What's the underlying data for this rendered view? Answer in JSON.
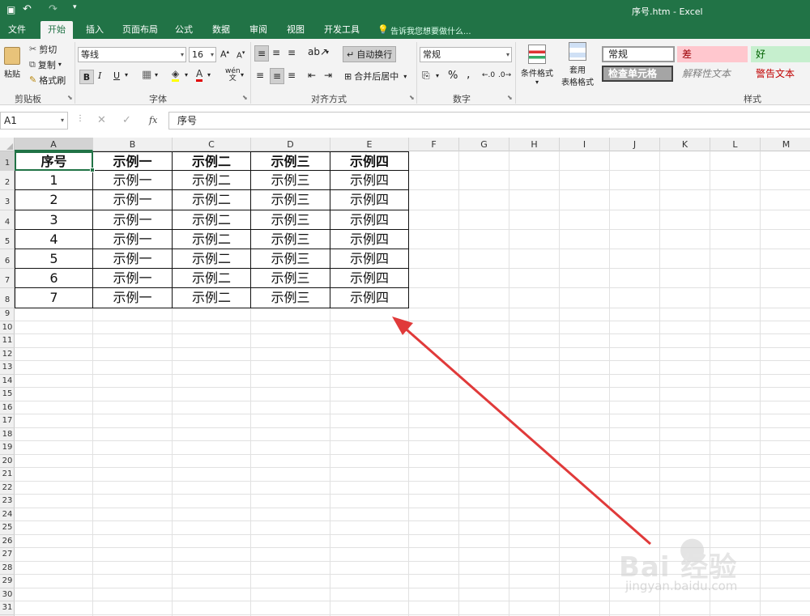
{
  "window": {
    "title": "序号.htm - Excel"
  },
  "tabs": [
    "文件",
    "开始",
    "插入",
    "页面布局",
    "公式",
    "数据",
    "审阅",
    "视图",
    "开发工具"
  ],
  "active_tab": "开始",
  "tell_me": "告诉我您想要做什么...",
  "clipboard": {
    "paste": "粘贴",
    "cut": "剪切",
    "copy": "复制",
    "format_painter": "格式刷",
    "label": "剪贴板"
  },
  "font": {
    "name": "等线",
    "size": "16",
    "bold": "B",
    "italic": "I",
    "underline": "U",
    "label": "字体"
  },
  "alignment": {
    "wrap": "自动换行",
    "merge": "合并后居中",
    "label": "对齐方式"
  },
  "number": {
    "format": "常规",
    "percent": "%",
    "comma": ",",
    "label": "数字"
  },
  "styles_group": {
    "cond_format": "条件格式",
    "table_format_1": "套用",
    "table_format_2": "表格格式",
    "normal": "常规",
    "bad": "差",
    "good": "好",
    "check_cell": "检查单元格",
    "explanatory": "解释性文本",
    "warning": "警告文本",
    "label": "样式"
  },
  "formula_bar": {
    "name_box": "A1",
    "fx": "fx",
    "value": "序号"
  },
  "columns": [
    "A",
    "B",
    "C",
    "D",
    "E",
    "F",
    "G",
    "H",
    "I",
    "J",
    "K",
    "L",
    "M"
  ],
  "rows": [
    "1",
    "2",
    "3",
    "4",
    "5",
    "6",
    "7",
    "8",
    "9",
    "10",
    "11",
    "12",
    "13",
    "14",
    "15",
    "16",
    "17",
    "18",
    "19",
    "20",
    "21",
    "22",
    "23",
    "24",
    "25",
    "26",
    "27",
    "28",
    "29",
    "30",
    "31"
  ],
  "table": {
    "header": [
      "序号",
      "示例一",
      "示例二",
      "示例三",
      "示例四"
    ],
    "body": [
      [
        "1",
        "示例一",
        "示例二",
        "示例三",
        "示例四"
      ],
      [
        "2",
        "示例一",
        "示例二",
        "示例三",
        "示例四"
      ],
      [
        "3",
        "示例一",
        "示例二",
        "示例三",
        "示例四"
      ],
      [
        "4",
        "示例一",
        "示例二",
        "示例三",
        "示例四"
      ],
      [
        "5",
        "示例一",
        "示例二",
        "示例三",
        "示例四"
      ],
      [
        "6",
        "示例一",
        "示例二",
        "示例三",
        "示例四"
      ],
      [
        "7",
        "示例一",
        "示例二",
        "示例三",
        "示例四"
      ]
    ]
  },
  "watermark": {
    "brand": "Bai 经验",
    "url": "jingyan.baidu.com"
  },
  "colors": {
    "excel_green": "#217346",
    "arrow": "#e03a3a",
    "bad_bg": "#ffc7ce",
    "good_bg": "#c6efce",
    "warning_text": "#c00000"
  }
}
